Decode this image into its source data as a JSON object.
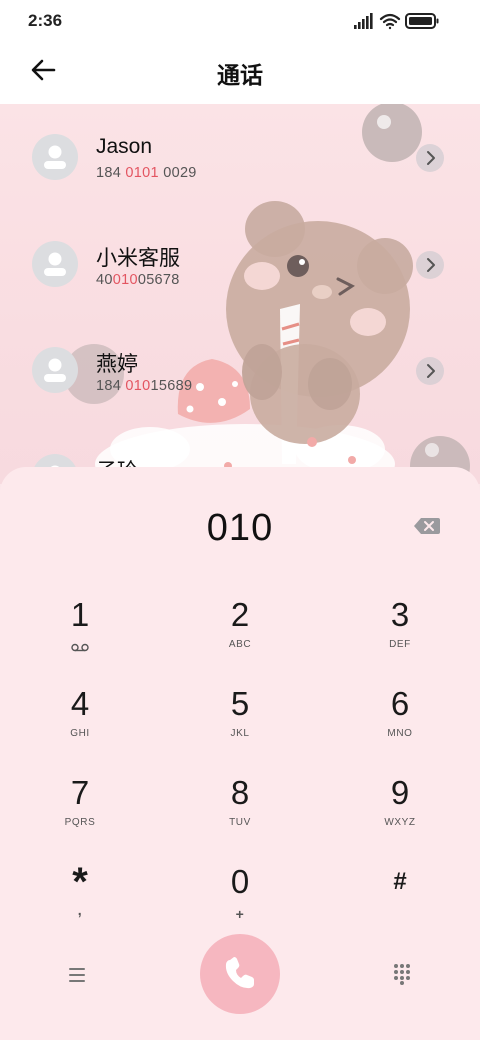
{
  "status_bar": {
    "time": "2:36",
    "icons": [
      "signal-icon",
      "wifi-icon",
      "battery-icon"
    ]
  },
  "header": {
    "title": "通话",
    "back_icon": "back-arrow-icon"
  },
  "contacts": [
    {
      "name": "Jason",
      "number_parts": [
        "184 ",
        "0101",
        " 0029"
      ]
    },
    {
      "name": "小米客服",
      "number_parts": [
        "40",
        "010",
        "05678"
      ]
    },
    {
      "name": "燕婷",
      "number_parts": [
        "184 ",
        "010",
        "15689"
      ]
    },
    {
      "name": "子玲",
      "number_parts": [
        "",
        "",
        ""
      ]
    }
  ],
  "dialer": {
    "input": "010",
    "keys": [
      {
        "digit": "1",
        "sub": "",
        "sub_icon": "voicemail-icon"
      },
      {
        "digit": "2",
        "sub": "ABC"
      },
      {
        "digit": "3",
        "sub": "DEF"
      },
      {
        "digit": "4",
        "sub": "GHI"
      },
      {
        "digit": "5",
        "sub": "JKL"
      },
      {
        "digit": "6",
        "sub": "MNO"
      },
      {
        "digit": "7",
        "sub": "PQRS"
      },
      {
        "digit": "8",
        "sub": "TUV"
      },
      {
        "digit": "9",
        "sub": "WXYZ"
      },
      {
        "digit": "*",
        "sub": ","
      },
      {
        "digit": "0",
        "sub": "+"
      },
      {
        "digit": "#",
        "sub": ""
      }
    ]
  },
  "colors": {
    "highlight": "#e35561",
    "call_button": "#f6b7c0",
    "panel": "#fde9ec"
  }
}
